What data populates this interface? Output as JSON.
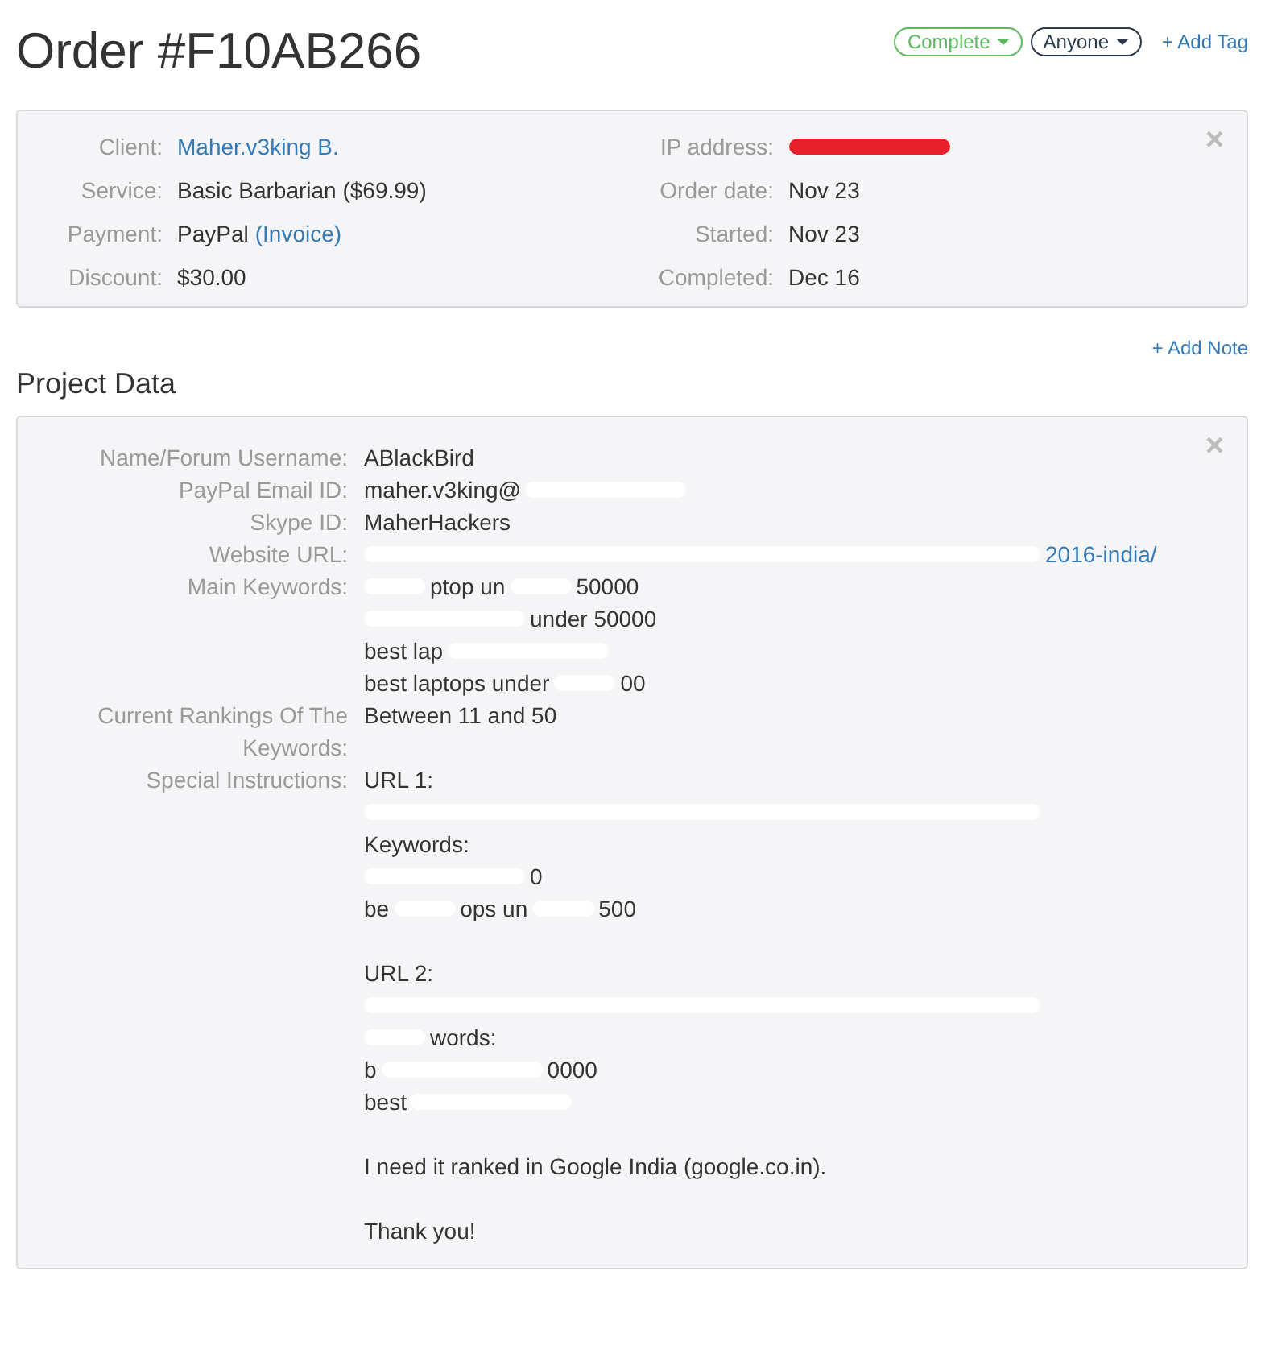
{
  "title": "Order #F10AB266",
  "tags": [
    {
      "label": "Complete",
      "color": "#5cb85c"
    },
    {
      "label": "Anyone",
      "color": "#2b3a4a"
    }
  ],
  "add_tag": "+ Add Tag",
  "order_info": {
    "close": "×",
    "left": [
      {
        "label": "Client:",
        "value": [
          {
            "kind": "link",
            "text": "Maher.v3king B."
          }
        ]
      },
      {
        "label": "Service:",
        "value": [
          {
            "kind": "text",
            "text": "Basic Barbarian ($69.99)"
          }
        ]
      },
      {
        "label": "Payment:",
        "value": [
          {
            "kind": "text",
            "text": "PayPal"
          },
          {
            "kind": "link",
            "text": "(Invoice)"
          }
        ]
      },
      {
        "label": "Discount:",
        "value": [
          {
            "kind": "text",
            "text": "$30.00"
          }
        ]
      }
    ],
    "right": [
      {
        "label": "IP address:",
        "value": [
          {
            "kind": "redaction-medium",
            "color": "#e8202a"
          }
        ]
      },
      {
        "label": "Order date:",
        "value": [
          {
            "kind": "text",
            "text": "Nov 23"
          }
        ]
      },
      {
        "label": "Started:",
        "value": [
          {
            "kind": "text",
            "text": "Nov 23"
          }
        ]
      },
      {
        "label": "Completed:",
        "value": [
          {
            "kind": "text",
            "text": "Dec 16"
          }
        ]
      }
    ]
  },
  "add_note": "+ Add Note",
  "project": {
    "heading": "Project Data",
    "close": "×",
    "fields": [
      {
        "label": "Name/Forum Username:",
        "lines": [
          {
            "kind": "text",
            "segments": [
              {
                "kind": "text",
                "text": "ABlackBird"
              }
            ]
          }
        ]
      },
      {
        "label": "PayPal Email ID:",
        "lines": [
          {
            "kind": "text",
            "segments": [
              {
                "kind": "text",
                "text": "maher.v3king@"
              },
              {
                "kind": "redaction-medium",
                "color": "#ffffff"
              }
            ]
          }
        ]
      },
      {
        "label": "Skype ID:",
        "lines": [
          {
            "kind": "text",
            "segments": [
              {
                "kind": "text",
                "text": "MaherHackers"
              }
            ]
          }
        ]
      },
      {
        "label": "Website URL:",
        "lines": [
          {
            "kind": "text",
            "segments": [
              {
                "kind": "redaction-long",
                "color": "#ffffff"
              },
              {
                "kind": "link",
                "text": "2016-india/"
              }
            ]
          }
        ]
      },
      {
        "label": "Main Keywords:",
        "lines": [
          {
            "kind": "text",
            "segments": [
              {
                "kind": "redaction-short",
                "color": "#ffffff"
              },
              {
                "kind": "text",
                "text": "ptop un"
              },
              {
                "kind": "redaction-short",
                "color": "#ffffff"
              },
              {
                "kind": "text",
                "text": "50000"
              }
            ]
          },
          {
            "kind": "text",
            "segments": [
              {
                "kind": "redaction-medium",
                "color": "#ffffff"
              },
              {
                "kind": "text",
                "text": "under 50000"
              }
            ]
          },
          {
            "kind": "text",
            "segments": [
              {
                "kind": "text",
                "text": "best lap"
              },
              {
                "kind": "redaction-medium",
                "color": "#ffffff"
              }
            ]
          },
          {
            "kind": "text",
            "segments": [
              {
                "kind": "text",
                "text": "best laptops under"
              },
              {
                "kind": "redaction-short",
                "color": "#ffffff"
              },
              {
                "kind": "text",
                "text": "00"
              }
            ]
          }
        ]
      },
      {
        "label": "Current Rankings Of The Keywords:",
        "lines": [
          {
            "kind": "text",
            "segments": [
              {
                "kind": "text",
                "text": "Between 11 and 50"
              }
            ]
          }
        ]
      },
      {
        "label": "Special Instructions:",
        "lines": [
          {
            "kind": "text",
            "segments": [
              {
                "kind": "text",
                "text": "URL 1:"
              }
            ]
          },
          {
            "kind": "text",
            "segments": [
              {
                "kind": "redaction-long",
                "color": "#ffffff"
              }
            ]
          },
          {
            "kind": "text",
            "segments": [
              {
                "kind": "text",
                "text": "Keywords:"
              }
            ]
          },
          {
            "kind": "text",
            "segments": [
              {
                "kind": "redaction-medium",
                "color": "#ffffff"
              },
              {
                "kind": "text",
                "text": "0"
              }
            ]
          },
          {
            "kind": "text",
            "segments": [
              {
                "kind": "text",
                "text": "be"
              },
              {
                "kind": "redaction-short",
                "color": "#ffffff"
              },
              {
                "kind": "text",
                "text": "ops un"
              },
              {
                "kind": "redaction-short",
                "color": "#ffffff"
              },
              {
                "kind": "text",
                "text": "500"
              }
            ]
          },
          {
            "kind": "gap"
          },
          {
            "kind": "text",
            "segments": [
              {
                "kind": "text",
                "text": "URL 2:"
              }
            ]
          },
          {
            "kind": "text",
            "segments": [
              {
                "kind": "redaction-long",
                "color": "#ffffff"
              }
            ]
          },
          {
            "kind": "text",
            "segments": [
              {
                "kind": "redaction-short",
                "color": "#ffffff"
              },
              {
                "kind": "text",
                "text": "words:"
              }
            ]
          },
          {
            "kind": "text",
            "segments": [
              {
                "kind": "text",
                "text": "b"
              },
              {
                "kind": "redaction-medium",
                "color": "#ffffff"
              },
              {
                "kind": "text",
                "text": "0000"
              }
            ]
          },
          {
            "kind": "text",
            "segments": [
              {
                "kind": "text",
                "text": "best"
              },
              {
                "kind": "redaction-medium",
                "color": "#ffffff"
              }
            ]
          },
          {
            "kind": "gap"
          },
          {
            "kind": "text",
            "segments": [
              {
                "kind": "text",
                "text": "I need it ranked in Google India (google.co.in)."
              }
            ]
          },
          {
            "kind": "gap"
          },
          {
            "kind": "text",
            "segments": [
              {
                "kind": "text",
                "text": "Thank you!"
              }
            ]
          }
        ]
      }
    ]
  }
}
